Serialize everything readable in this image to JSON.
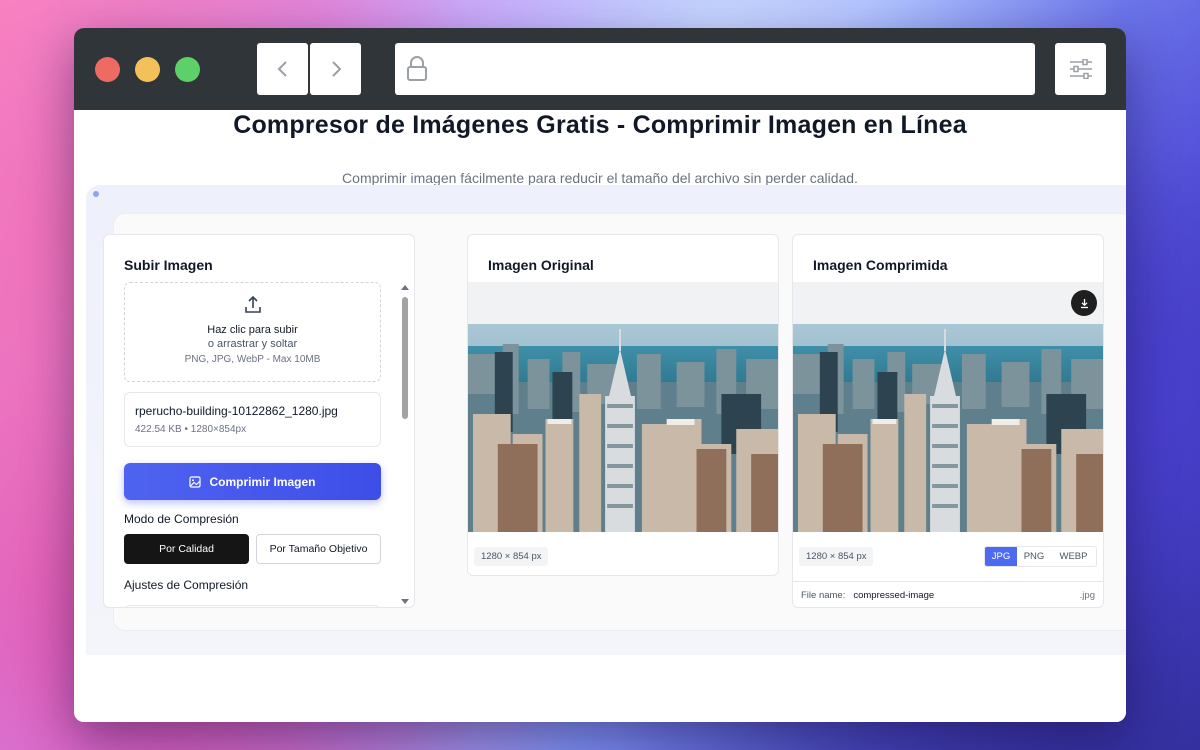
{
  "browser": {
    "icons": [
      "chevron-left-icon",
      "chevron-right-icon",
      "lock-icon",
      "sliders-icon"
    ]
  },
  "page": {
    "title": "Compresor de Imágenes Gratis - Comprimir Imagen en Línea",
    "description": "Comprimir imagen fácilmente para reducir el tamaño del archivo sin perder calidad. Ideal para optimización web, adjuntos de correo y gestión de almacenamiento. Compatible con múltiples formatos y niveles de compresión."
  },
  "upload": {
    "title": "Subir Imagen",
    "dropzone_main": "Haz clic para subir",
    "dropzone_sub": "o arrastrar y soltar",
    "dropzone_hint": "PNG, JPG, WebP - Max 10MB",
    "file_name": "rperucho-building-10122862_1280.jpg",
    "file_meta": "422.54 KB • 1280×854px",
    "compress_label": "Comprimir Imagen",
    "mode_label": "Modo de Compresión",
    "mode_quality": "Por Calidad",
    "mode_target": "Por Tamaño Objetivo",
    "settings_label": "Ajustes de Compresión"
  },
  "original": {
    "title": "Imagen Original",
    "dimensions": "1280 × 854 px"
  },
  "compressed": {
    "title": "Imagen Comprimida",
    "dimensions": "1280 × 854 px",
    "formats": [
      "JPG",
      "PNG",
      "WEBP"
    ],
    "selected_format": "JPG",
    "file_name_label": "File name:",
    "file_name_value": "compressed-image",
    "extension": ".jpg"
  },
  "colors": {
    "accent": "#4d6bf0",
    "titlebar": "#2f3538",
    "dark_button": "#151515"
  }
}
